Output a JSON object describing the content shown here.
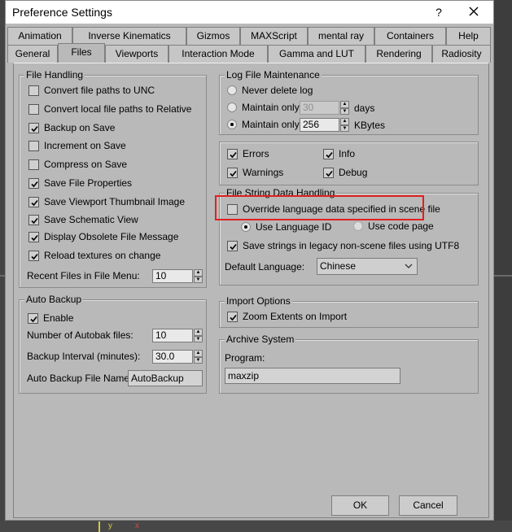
{
  "window": {
    "title": "Preference Settings",
    "help_label": "?",
    "close_label": "×"
  },
  "tabs_row1": [
    "Animation",
    "Inverse Kinematics",
    "Gizmos",
    "MAXScript",
    "mental ray",
    "Containers",
    "Help"
  ],
  "tabs_row2": [
    "General",
    "Files",
    "Viewports",
    "Interaction Mode",
    "Gamma and LUT",
    "Rendering",
    "Radiosity"
  ],
  "active_tab": "Files",
  "file_handling": {
    "label": "File Handling",
    "items": [
      {
        "label": "Convert file paths to UNC",
        "checked": false
      },
      {
        "label": "Convert local file paths to Relative",
        "checked": false
      },
      {
        "label": "Backup on Save",
        "checked": true
      },
      {
        "label": "Increment on Save",
        "checked": false
      },
      {
        "label": "Compress on Save",
        "checked": false
      },
      {
        "label": "Save File Properties",
        "checked": true
      },
      {
        "label": "Save Viewport Thumbnail Image",
        "checked": true
      },
      {
        "label": "Save Schematic View",
        "checked": true
      },
      {
        "label": "Display Obsolete File Message",
        "checked": true
      },
      {
        "label": "Reload textures on change",
        "checked": true
      }
    ],
    "recent_label": "Recent Files in File Menu:",
    "recent_value": "10"
  },
  "auto_backup": {
    "label": "Auto Backup",
    "enable_label": "Enable",
    "enable_checked": true,
    "number_label": "Number of Autobak files:",
    "number_value": "10",
    "interval_label": "Backup Interval (minutes):",
    "interval_value": "30.0",
    "filename_label": "Auto Backup File Name:",
    "filename_value": "AutoBackup"
  },
  "log_file": {
    "label": "Log File Maintenance",
    "never_label": "Never delete log",
    "maintain_days_label": "Maintain only",
    "days_value": "30",
    "days_unit": "days",
    "maintain_kb_label": "Maintain only",
    "kb_value": "256",
    "kb_unit": "KBytes",
    "selected": "kbytes",
    "errors_label": "Errors",
    "info_label": "Info",
    "warnings_label": "Warnings",
    "debug_label": "Debug"
  },
  "file_string": {
    "label": "File String Data Handling",
    "override_label": "Override language data specified in scene file",
    "override_checked": false,
    "use_language_id_label": "Use Language ID",
    "use_code_page_label": "Use code page",
    "selected": "language_id",
    "utf8_label": "Save strings in legacy non-scene files using UTF8",
    "utf8_checked": true,
    "default_language_label": "Default Language:",
    "default_language_value": "Chinese"
  },
  "import_options": {
    "label": "Import Options",
    "zoom_label": "Zoom Extents on Import",
    "zoom_checked": true
  },
  "archive": {
    "label": "Archive System",
    "program_label": "Program:",
    "program_value": "maxzip"
  },
  "buttons": {
    "ok": "OK",
    "cancel": "Cancel"
  },
  "viewport_axes": {
    "y": "y",
    "x": "x"
  },
  "colors": {
    "dialog_bg": "#b9b9b9",
    "highlight": "#e02020",
    "axis_y": "#d8c84a",
    "axis_x": "#d24a4a"
  }
}
